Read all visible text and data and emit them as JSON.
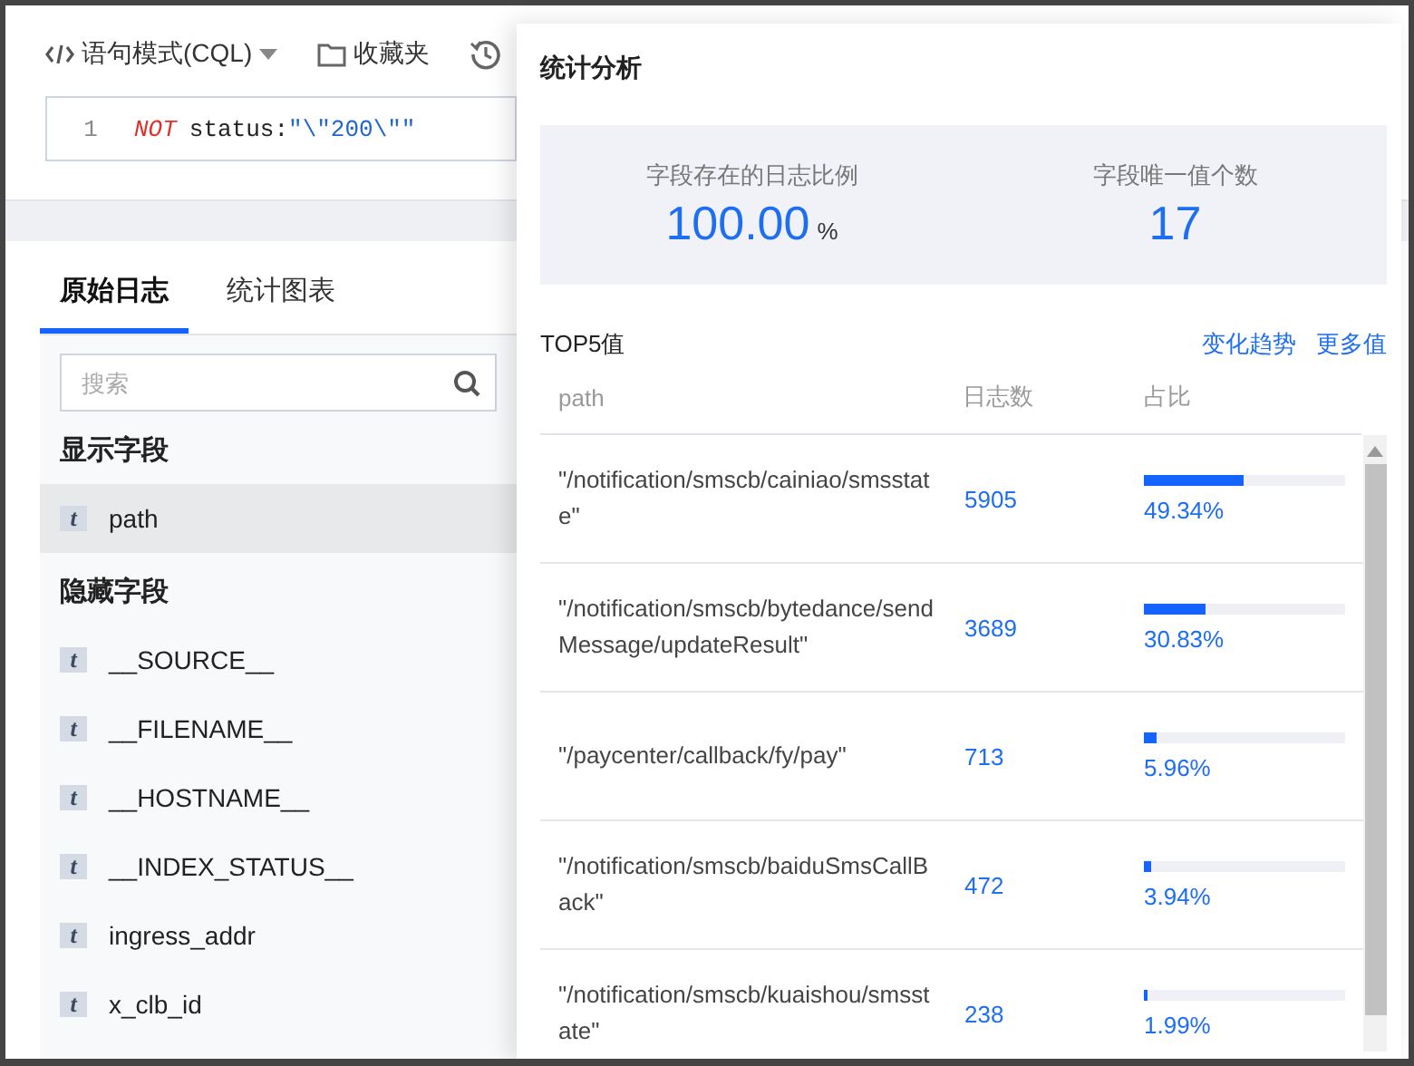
{
  "toolbar": {
    "mode_label": "语句模式(CQL)",
    "favorites_label": "收藏夹"
  },
  "query_editor": {
    "line_number": "1",
    "keyword": "NOT",
    "field": "status:",
    "value": "\"\\\"200\\\"\""
  },
  "tabs": [
    {
      "label": "原始日志",
      "selected": true
    },
    {
      "label": "统计图表",
      "selected": false
    }
  ],
  "field_search": {
    "placeholder": "搜索"
  },
  "field_groups": [
    {
      "title": "显示字段",
      "fields": [
        {
          "type_badge": "t",
          "name": "path",
          "selected": true
        }
      ]
    },
    {
      "title": "隐藏字段",
      "fields": [
        {
          "type_badge": "t",
          "name": "__SOURCE__",
          "selected": false
        },
        {
          "type_badge": "t",
          "name": "__FILENAME__",
          "selected": false
        },
        {
          "type_badge": "t",
          "name": "__HOSTNAME__",
          "selected": false
        },
        {
          "type_badge": "t",
          "name": "__INDEX_STATUS__",
          "selected": false
        },
        {
          "type_badge": "t",
          "name": "ingress_addr",
          "selected": false
        },
        {
          "type_badge": "t",
          "name": "x_clb_id",
          "selected": false
        }
      ]
    }
  ],
  "stats_panel": {
    "title": "统计分析",
    "metrics": [
      {
        "label": "字段存在的日志比例",
        "value": "100.00",
        "unit": "%"
      },
      {
        "label": "字段唯一值个数",
        "value": "17"
      }
    ],
    "top_title": "TOP5值",
    "links": [
      "变化趋势",
      "更多值"
    ],
    "columns": [
      "path",
      "日志数",
      "占比"
    ],
    "rows": [
      {
        "value": "\"/notification/smscb/cainiao/smsstate\"",
        "count": "5905",
        "level": 0.4934,
        "percent": "49.34%"
      },
      {
        "value": "\"/notification/smscb/bytedance/sendMessage/updateResult\"",
        "count": "3689",
        "level": 0.3083,
        "percent": "30.83%"
      },
      {
        "value": "\"/paycenter/callback/fy/pay\"",
        "count": "713",
        "level": 0.0596,
        "percent": "5.96%"
      },
      {
        "value": "\"/notification/smscb/baiduSmsCallBack\"",
        "count": "472",
        "level": 0.0394,
        "percent": "3.94%"
      },
      {
        "value": "\"/notification/smscb/kuaishou/smsstate\"",
        "count": "238",
        "level": 0.0199,
        "percent": "1.99%"
      }
    ]
  }
}
